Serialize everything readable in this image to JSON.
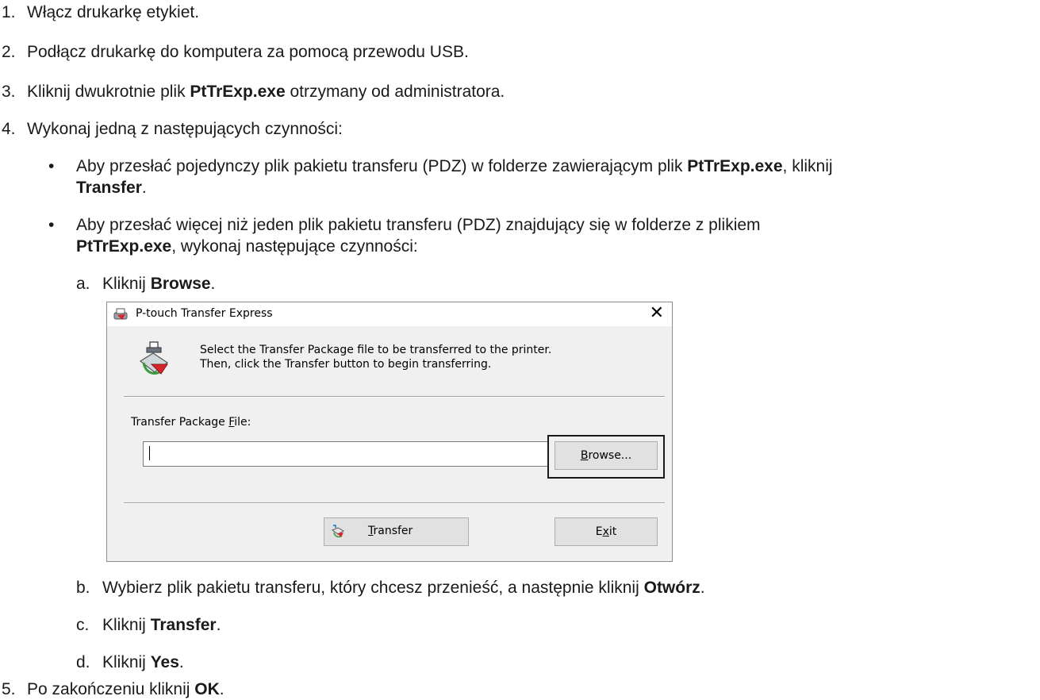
{
  "steps": [
    {
      "num": "1.",
      "text": "Włącz drukarkę etykiet."
    },
    {
      "num": "2.",
      "text": "Podłącz drukarkę do komputera za pomocą przewodu USB."
    },
    {
      "num": "3.",
      "pre": "Kliknij dwukrotnie plik ",
      "bold": "PtTrExp.exe",
      "post": " otrzymany od administratora."
    },
    {
      "num": "4.",
      "text": "Wykonaj jedną z następujących czynności:"
    },
    {
      "num": "5.",
      "pre": "Po zakończeniu kliknij ",
      "bold": "OK",
      "post": "."
    }
  ],
  "bullets": [
    {
      "line1_pre": "Aby przesłać pojedynczy plik pakietu transferu (PDZ) w folderze zawierającym plik ",
      "line1_bold": "PtTrExp.exe",
      "line1_post": ", kliknij",
      "line2_bold": "Transfer",
      "line2_post": "."
    },
    {
      "line1": "Aby przesłać więcej niż jeden plik pakietu transferu (PDZ) znajdujący się w folderze z plikiem",
      "line2_bold": "PtTrExp.exe",
      "line2_post": ", wykonaj następujące czynności:"
    }
  ],
  "bullet_glyph": "•",
  "substeps": [
    {
      "letter": "a.",
      "pre": "Kliknij ",
      "bold": "Browse",
      "post": "."
    },
    {
      "letter": "b.",
      "pre": "Wybierz plik pakietu transferu, który chcesz przenieść, a następnie kliknij ",
      "bold": "Otwórz",
      "post": "."
    },
    {
      "letter": "c.",
      "pre": "Kliknij ",
      "bold": "Transfer",
      "post": "."
    },
    {
      "letter": "d.",
      "pre": "Kliknij ",
      "bold": "Yes",
      "post": "."
    }
  ],
  "dialog": {
    "title": "P-touch Transfer Express",
    "close_glyph": "✕",
    "message_line1": "Select the Transfer Package file to be transferred to the printer.",
    "message_line2": "Then, click the Transfer  button to begin transferring.",
    "file_label_pre": "Transfer Package ",
    "file_label_mn": "F",
    "file_label_post": "ile:",
    "file_value": "",
    "browse_mn": "B",
    "browse_rest": "rowse...",
    "transfer_mn": "T",
    "transfer_rest": "ransfer",
    "exit_pre": "E",
    "exit_mn": "x",
    "exit_post": "it",
    "accent_red": "#d6262b",
    "icon_names": [
      "printer-app-icon",
      "transfer-package-icon",
      "transfer-button-icon"
    ]
  }
}
